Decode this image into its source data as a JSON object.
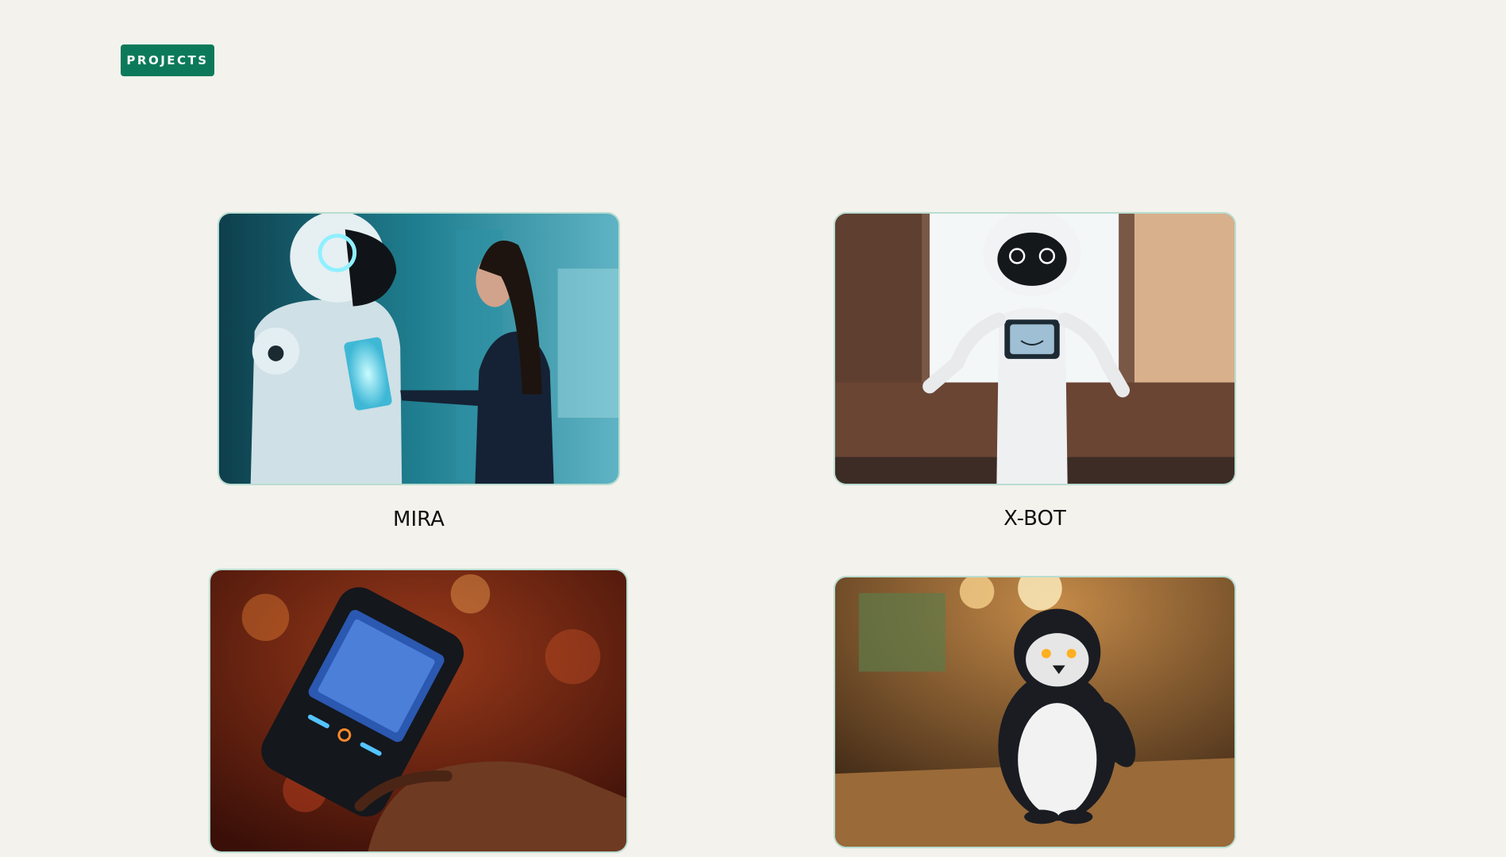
{
  "section": {
    "badge_label": "PROJECTS"
  },
  "colors": {
    "background": "#f3f2ec",
    "badge": "#0c7a5a",
    "card_border": "#b9ddd1"
  },
  "projects": [
    {
      "title": "MIRA",
      "image": "humanoid-robot-with-woman-illustration"
    },
    {
      "title": "X-BOT",
      "image": "white-service-robot-illustration"
    },
    {
      "title": "",
      "image": "handheld-device-illustration"
    },
    {
      "title": "",
      "image": "penguin-robot-illustration"
    }
  ]
}
